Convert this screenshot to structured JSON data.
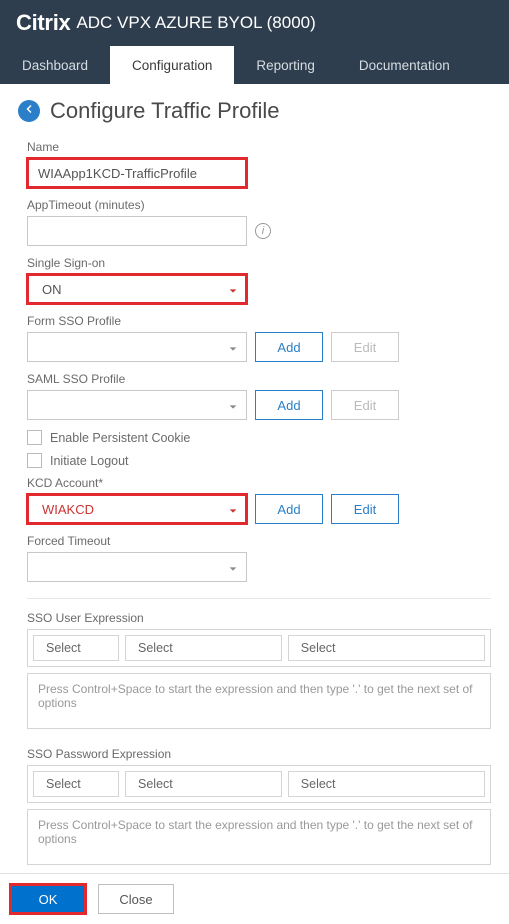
{
  "header": {
    "brand": "Citrix",
    "product": "ADC VPX AZURE BYOL (8000)"
  },
  "tabs": {
    "dashboard": "Dashboard",
    "configuration": "Configuration",
    "reporting": "Reporting",
    "documentation": "Documentation"
  },
  "page": {
    "title": "Configure Traffic Profile"
  },
  "form": {
    "name_label": "Name",
    "name_value": "WIAApp1KCD-TrafficProfile",
    "apptimeout_label": "AppTimeout (minutes)",
    "apptimeout_value": "",
    "sso_label": "Single Sign-on",
    "sso_value": "ON",
    "formsso_label": "Form SSO Profile",
    "formsso_value": "",
    "samlsso_label": "SAML SSO Profile",
    "samlsso_value": "",
    "persistent_cookie_label": "Enable Persistent Cookie",
    "initiate_logout_label": "Initiate Logout",
    "kcd_label": "KCD Account*",
    "kcd_value": "WIAKCD",
    "forced_timeout_label": "Forced Timeout",
    "forced_timeout_value": "",
    "sso_user_expr_label": "SSO User Expression",
    "sso_pwd_expr_label": "SSO Password Expression",
    "expr_hint": "Press Control+Space to start the expression and then type '.' to get the next set of options",
    "select_placeholder": "Select"
  },
  "buttons": {
    "add": "Add",
    "edit": "Edit",
    "ok": "OK",
    "close": "Close"
  }
}
